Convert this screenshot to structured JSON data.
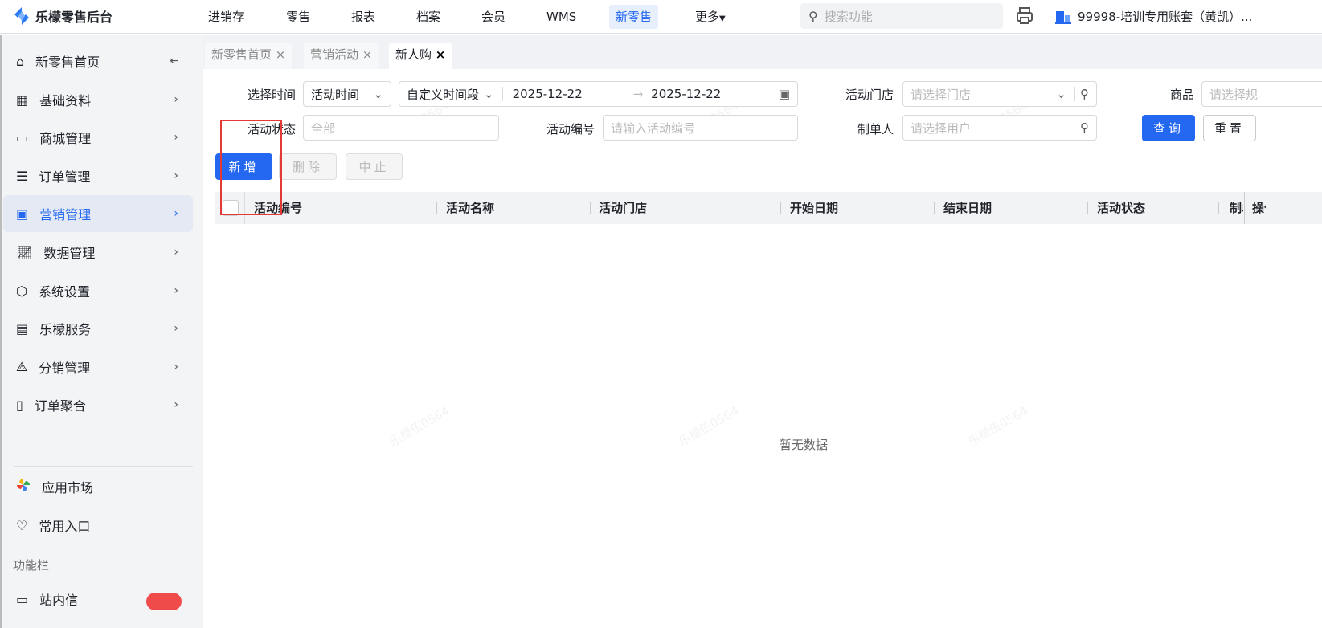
{
  "app": {
    "title": "乐檬零售后台"
  },
  "nav": [
    "进销存",
    "零售",
    "报表",
    "档案",
    "会员",
    "WMS",
    "新零售",
    "更多"
  ],
  "search": {
    "placeholder": "搜索功能"
  },
  "account": "99998-培训专用账套（黄凯）...",
  "sidebar": {
    "items": [
      "新零售首页",
      "基础资料",
      "商城管理",
      "订单管理",
      "营销管理",
      "数据管理",
      "系统设置",
      "乐檬服务",
      "分销管理",
      "订单聚合"
    ],
    "bottom": [
      "应用市场",
      "常用入口"
    ],
    "section": "功能栏",
    "partial": "站内信"
  },
  "tabs": [
    "新零售首页",
    "营销活动",
    "新人购"
  ],
  "filters": {
    "time_label": "选择时间",
    "time_type": "活动时间",
    "range_type": "自定义时间段",
    "start": "2025-12-22",
    "end": "2025-12-22",
    "store_label": "活动门店",
    "store_ph": "请选择门店",
    "goods_label": "商品",
    "goods_ph": "请选择规",
    "status_label": "活动状态",
    "status_ph": "全部",
    "code_label": "活动编号",
    "code_ph": "请输入活动编号",
    "maker_label": "制单人",
    "maker_ph": "请选择用户",
    "query": "查询",
    "reset": "重置"
  },
  "actions": {
    "add": "新增",
    "delete": "删除",
    "stop": "中止"
  },
  "table": {
    "columns": [
      "活动编号",
      "活动名称",
      "活动门店",
      "开始日期",
      "结束日期",
      "活动状态",
      "制单人",
      "操作"
    ],
    "empty": "暂无数据"
  },
  "watermark": "乐檬伍0564",
  "colors": {
    "accent": "#2468f2",
    "highlight": "#e53935"
  }
}
